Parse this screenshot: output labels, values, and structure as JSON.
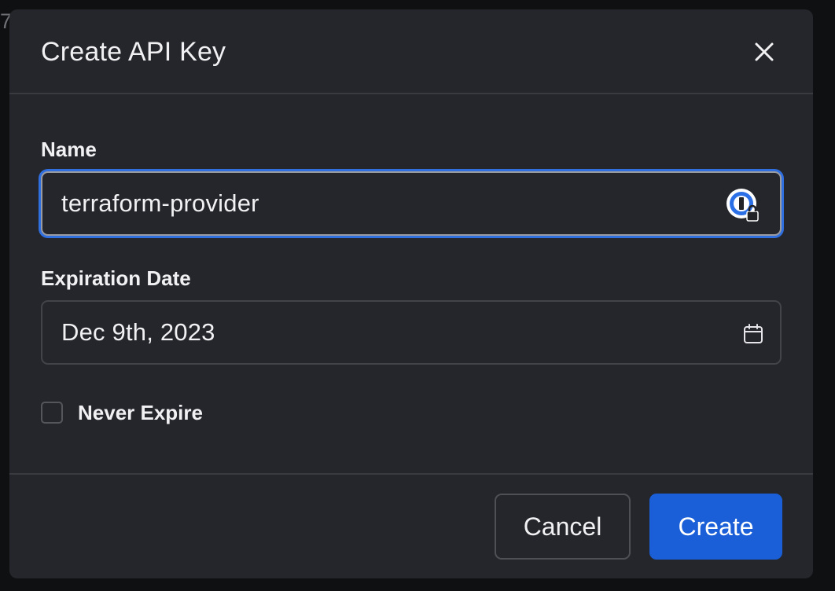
{
  "backdrop": {
    "partial_char": "7"
  },
  "modal": {
    "title": "Create API Key",
    "close_icon": "close-icon"
  },
  "form": {
    "name": {
      "label": "Name",
      "value": "terraform-provider",
      "focused": true,
      "trailing_icon": "password-manager-icon"
    },
    "expiration": {
      "label": "Expiration Date",
      "value": "Dec 9th, 2023",
      "trailing_icon": "calendar-icon"
    },
    "never_expire": {
      "label": "Never Expire",
      "checked": false
    }
  },
  "footer": {
    "cancel_label": "Cancel",
    "create_label": "Create"
  },
  "colors": {
    "modal_bg": "#25262b",
    "focus_ring": "#2f6fe0",
    "primary": "#1a5fd8"
  }
}
